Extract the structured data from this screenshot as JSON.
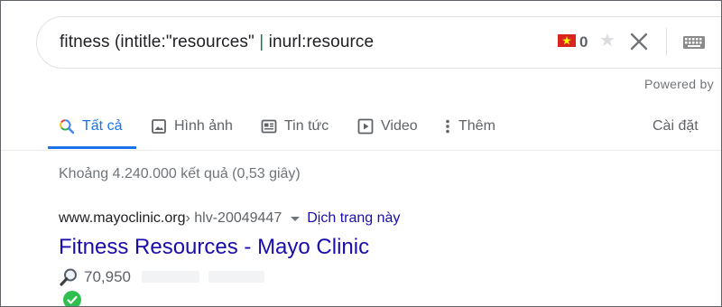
{
  "search": {
    "query_main": "fitness (intitle:\"resources\" ",
    "query_pipe": "|",
    "query_tail": " inurl:resource",
    "flag_count": "0",
    "powered_by": "Powered by"
  },
  "tabs": [
    {
      "label": "Tất cả",
      "icon": "search-icon",
      "active": true
    },
    {
      "label": "Hình ảnh",
      "icon": "image-icon"
    },
    {
      "label": "Tin tức",
      "icon": "news-icon"
    },
    {
      "label": "Video",
      "icon": "video-icon"
    },
    {
      "label": "Thêm",
      "icon": "more-vert-icon"
    }
  ],
  "settings_label": "Cài đặt",
  "stats": "Khoảng 4.240.000 kết quả (0,53 giây)",
  "result": {
    "host": "www.mayoclinic.org",
    "path": " › hlv-20049447",
    "translate": "Dịch trang này",
    "title": "Fitness Resources - Mayo Clinic",
    "metric": "70,950"
  },
  "colors": {
    "accent": "#1a73e8",
    "link": "#1a0dab",
    "flag": "#da251d",
    "check": "#2fbf4f"
  }
}
